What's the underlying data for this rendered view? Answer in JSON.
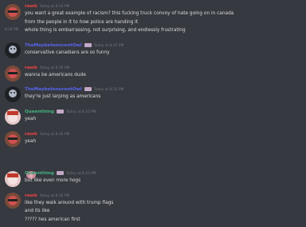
{
  "colors": {
    "rawb": "#ed4245",
    "maybe": "#5865f2",
    "queen": "#43b581",
    "text": "#dcddde",
    "timestamp": "#72767d",
    "background": "#36393f"
  },
  "messages": [
    {
      "id": "m1",
      "author": "rawb",
      "timestamp": "Today at 8:33 PM",
      "lines": [
        "you want a great example of racism? this fucking truck convoy of hate going on in canada",
        "from the people in it to how police are handing it"
      ]
    },
    {
      "id": "m1b",
      "hover_time": "8:34 PM",
      "lines": [
        "whole thing is embarrassing, not surprising, and endlessly frustrating"
      ]
    },
    {
      "id": "m2",
      "author": "TheMaybeInnocentOwl",
      "timestamp": "Today at 8:35 PM",
      "lines": [
        "conservative canadians are so funny"
      ]
    },
    {
      "id": "m3",
      "author": "rawb",
      "timestamp": "Today at 8:35 PM",
      "lines": [
        "wanna be americans dude"
      ]
    },
    {
      "id": "m4",
      "author": "TheMaybeInnocentOwl",
      "timestamp": "Today at 8:35 PM",
      "lines": [
        "they're just larping as americans"
      ]
    },
    {
      "id": "m5",
      "author": "Queenthing",
      "timestamp": "Today at 8:35 PM",
      "lines": [
        "yeah"
      ]
    },
    {
      "id": "m6",
      "author": "rawb",
      "timestamp": "Today at 8:35 PM",
      "lines": [
        "yeah"
      ],
      "sticker": "pig-sticker"
    },
    {
      "id": "m7",
      "author": "Queenthing",
      "timestamp": "Today at 8:35 PM",
      "lines": [
        "but like even more hogs"
      ]
    },
    {
      "id": "m8",
      "author": "rawb",
      "timestamp": "Today at 8:35 PM",
      "lines": [
        "like they walk around with trump flags",
        "and its like",
        "????? hes american first"
      ]
    }
  ]
}
